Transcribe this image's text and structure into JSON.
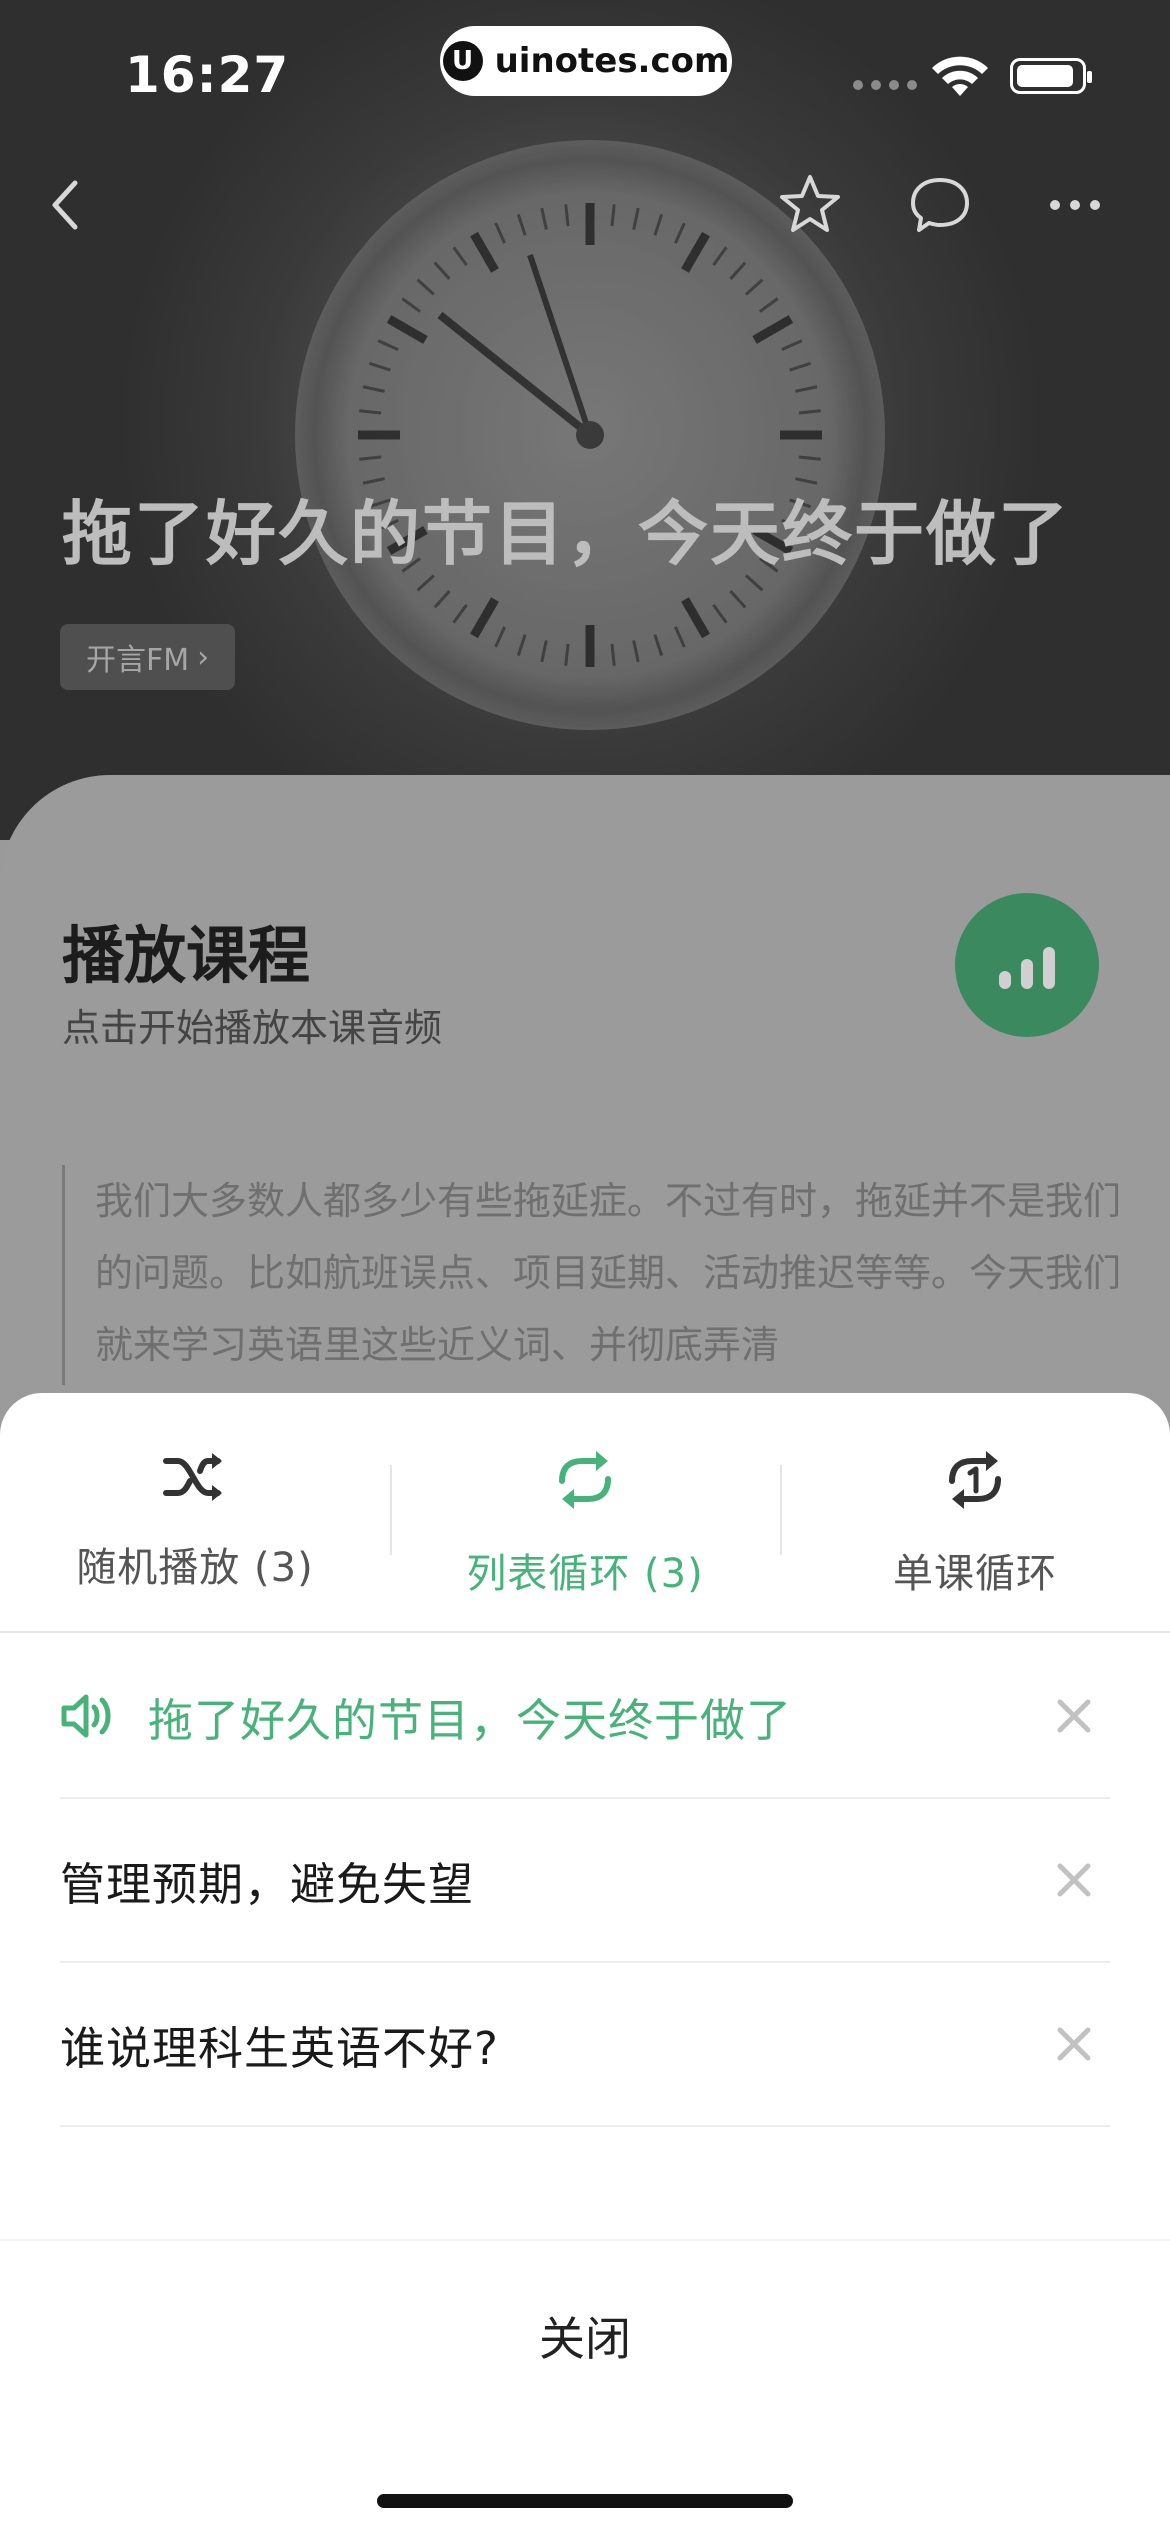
{
  "status_bar": {
    "time": "16:27",
    "url": "uinotes.com"
  },
  "header": {
    "title": "拖了好久的节目，今天终于做了",
    "channel": "开言FM",
    "channel_chevron": "›"
  },
  "course": {
    "section_title": "播放课程",
    "section_subtitle": "点击开始播放本课音频",
    "intro": "我们大多数人都多少有些拖延症。不过有时，拖延并不是我们的问题。比如航班误点、项目延期、活动推迟等等。今天我们就来学习英语里这些近义词、并彻底弄清"
  },
  "sheet": {
    "modes": [
      {
        "label": "随机播放 (3)",
        "icon": "shuffle-icon",
        "active": false
      },
      {
        "label": "列表循环 (3)",
        "icon": "repeat-icon",
        "active": true
      },
      {
        "label": "单课循环",
        "icon": "repeat-one-icon",
        "active": false
      }
    ],
    "playlist": [
      {
        "title": "拖了好久的节目，今天终于做了",
        "playing": true
      },
      {
        "title": "管理预期，避免失望",
        "playing": false
      },
      {
        "title": "谁说理科生英语不好?",
        "playing": false
      }
    ],
    "close_label": "关闭"
  },
  "colors": {
    "accent_green": "#47b37a",
    "play_button": "#3b8a5f",
    "overlay_gray": "#9b9b9b"
  }
}
